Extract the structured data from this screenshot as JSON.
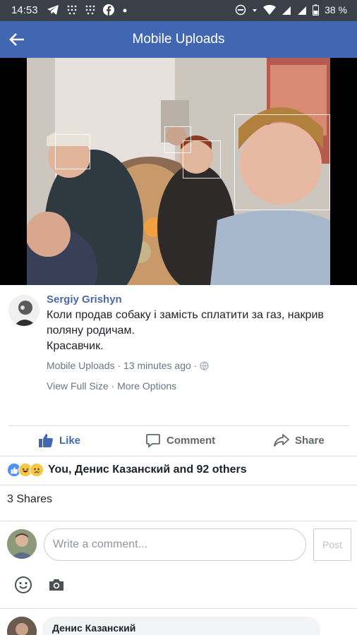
{
  "status_bar": {
    "time": "14:53",
    "battery": "38 %",
    "left_icons": [
      "telegram-icon",
      "grid-icon",
      "grid-icon",
      "facebook-icon",
      "dot-icon"
    ],
    "right_icons": [
      "do-not-disturb-icon",
      "data-arrow-icon",
      "wifi-icon",
      "signal-icon",
      "signal-icon",
      "battery-icon"
    ]
  },
  "app_bar": {
    "title": "Mobile Uploads",
    "back_icon": "arrow-left-icon",
    "color": "#4267b2"
  },
  "post": {
    "author": "Sergiy Grishyn",
    "text_lines": [
      "Коли продав собаку і замість сплатити за газ, накрив",
      "поляну родичам.",
      "Красавчик."
    ],
    "album": "Mobile Uploads",
    "time": "· 13 minutes ago ·",
    "privacy_icon": "globe-icon",
    "view_full_size": "View Full Size",
    "more_options": "· More Options"
  },
  "actions": {
    "like": "Like",
    "comment": "Comment",
    "share": "Share"
  },
  "reactions": {
    "icons": [
      "like-reaction-icon",
      "haha-reaction-icon",
      "sad-reaction-icon"
    ],
    "text": "You, Денис Казанский and 92 others"
  },
  "shares": "3 Shares",
  "comment_box": {
    "placeholder": "Write a comment...",
    "post_label": "Post"
  },
  "first_comment": {
    "author": "Денис Казанский"
  },
  "colors": {
    "facebook_blue": "#4267b2",
    "name_blue": "#4b6aa3",
    "meta_gray": "#6b7583"
  }
}
